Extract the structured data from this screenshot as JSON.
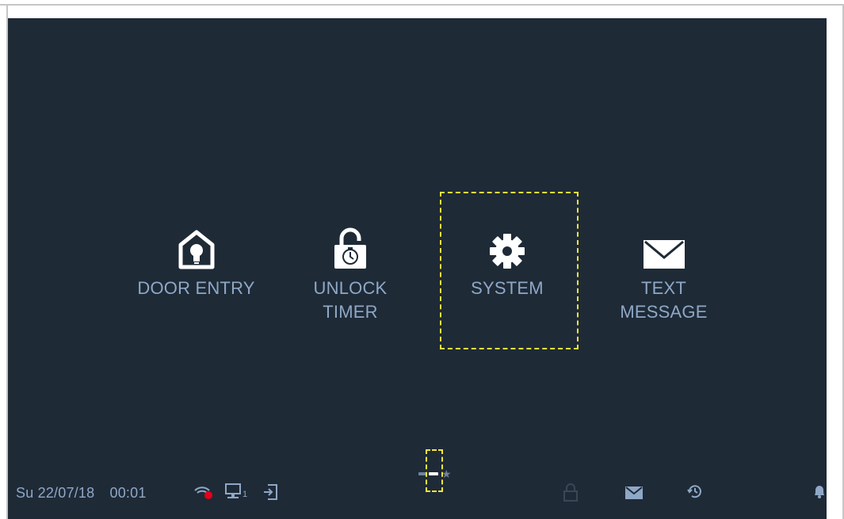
{
  "status_bar": {
    "date": "Su 22/07/18",
    "time": "00:01",
    "monitor_index": "1"
  },
  "menu": {
    "door_entry": {
      "label": "DOOR ENTRY",
      "icon": "house-bulb-icon"
    },
    "unlock_timer": {
      "label_line1": "UNLOCK",
      "label_line2": "TIMER",
      "icon": "padlock-timer-icon"
    },
    "system": {
      "label": "SYSTEM",
      "icon": "gear-icon"
    },
    "text_message": {
      "label_line1": "TEXT",
      "label_line2": "MESSAGE",
      "icon": "envelope-icon"
    }
  },
  "pager": {
    "pages": 2,
    "current": 2,
    "favorites_icon": "star-icon"
  },
  "colors": {
    "screen_bg": "#1f2a37",
    "label": "#8ea8c6",
    "icon": "#ffffff",
    "highlight": "#f2e53a",
    "alert": "#e3001b"
  }
}
